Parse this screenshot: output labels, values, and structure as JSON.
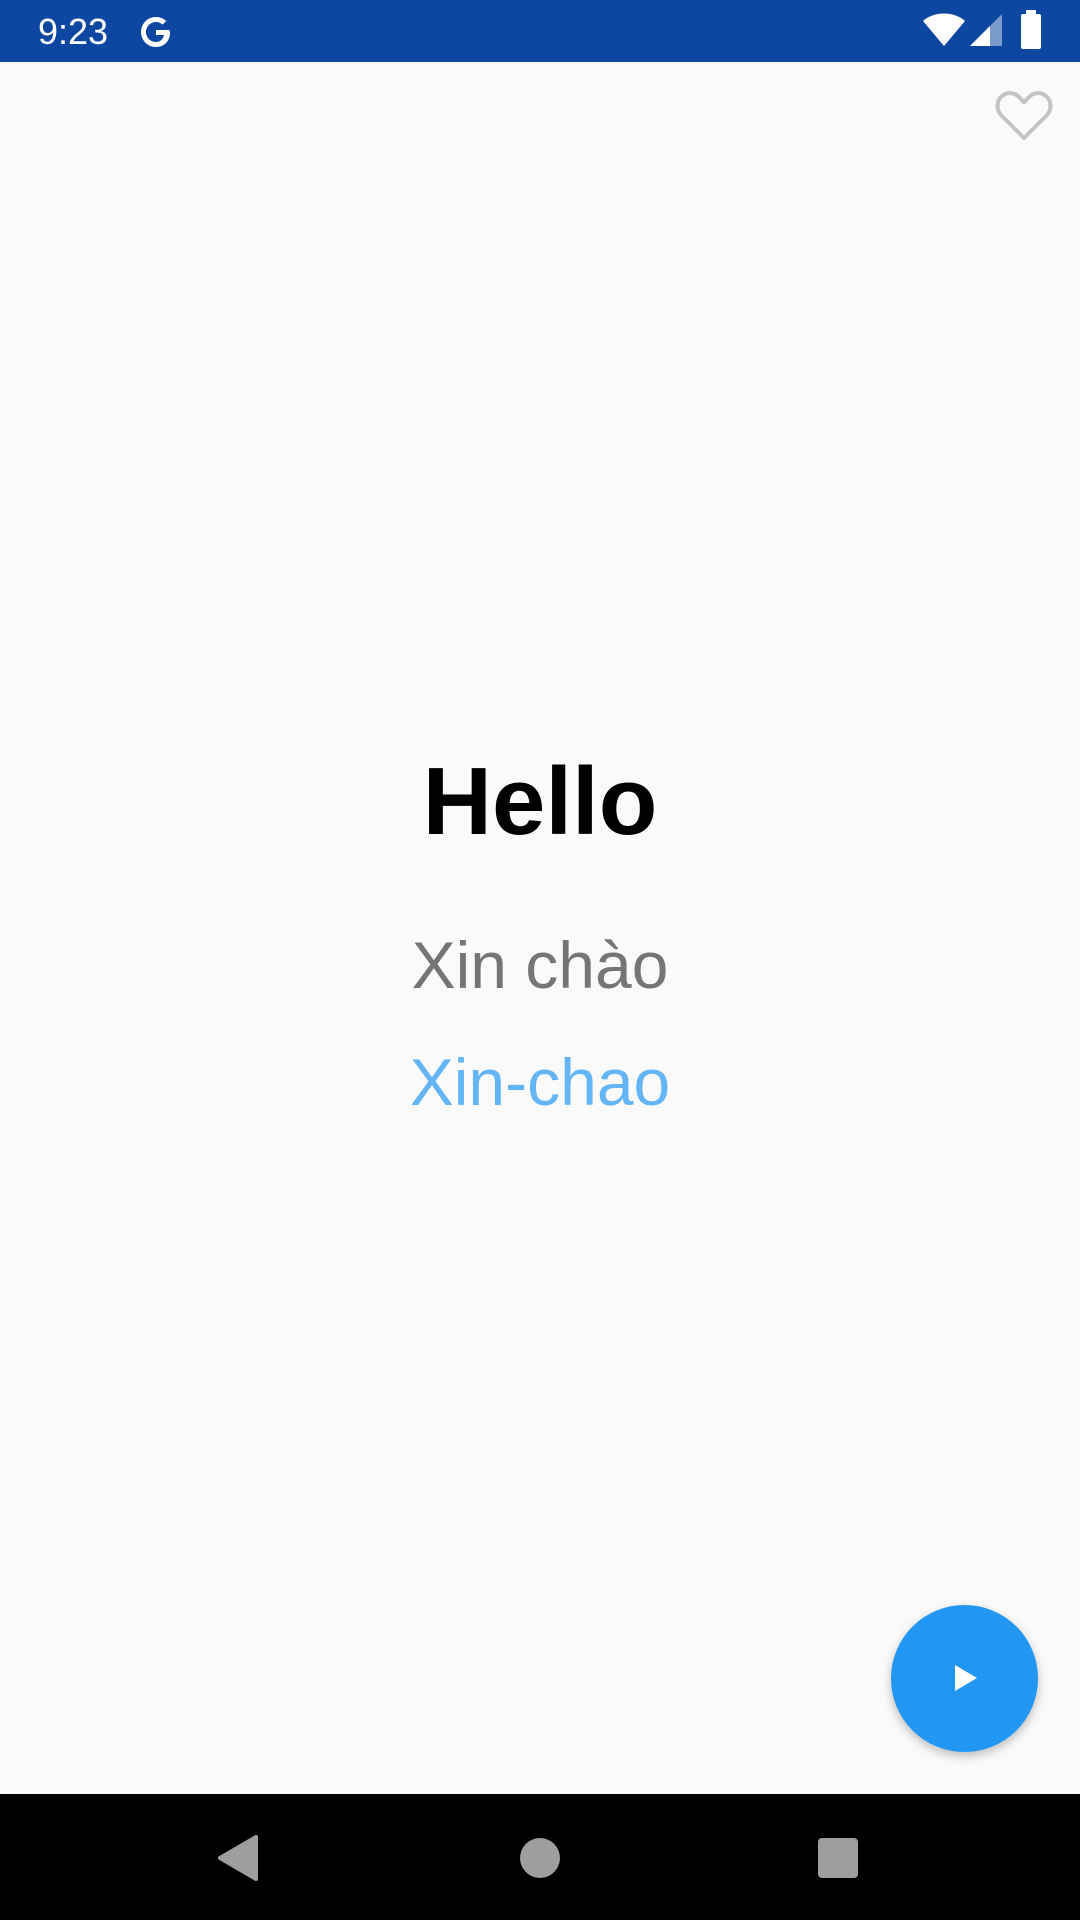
{
  "status_bar": {
    "time": "9:23",
    "background_color": "#0d47a1",
    "icons": [
      "google-icon",
      "wifi-icon",
      "signal-icon",
      "battery-icon"
    ]
  },
  "card": {
    "english_word": "Hello",
    "translation": "Xin chào",
    "pronunciation": "Xin-chao",
    "favorite_icon": "heart-outline-icon",
    "translation_color": "#757575",
    "pronunciation_color": "#64b5f6"
  },
  "fab": {
    "icon": "play-icon",
    "color": "#2196f3"
  },
  "nav_bar": {
    "icons": [
      "back-icon",
      "home-icon",
      "recents-icon"
    ]
  }
}
